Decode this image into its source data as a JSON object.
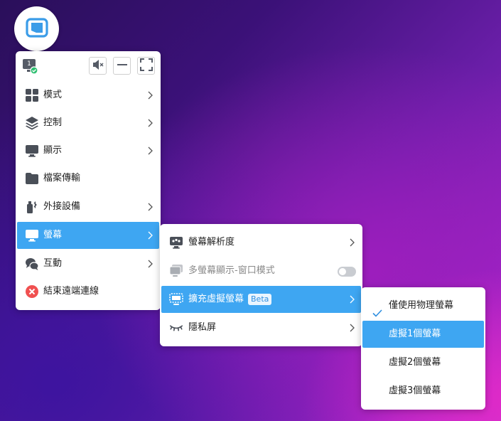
{
  "icons": {
    "app_logo": "app-logo-icon",
    "monitor_badge": "monitor-1-icon",
    "mute": "speaker-mute-icon",
    "minimize": "minimize-icon",
    "fullscreen": "fullscreen-icon"
  },
  "toolbar": {
    "monitor_number": "1"
  },
  "main_menu": {
    "items": [
      {
        "label": "模式",
        "icon": "grid-icon"
      },
      {
        "label": "控制",
        "icon": "layers-icon"
      },
      {
        "label": "顯示",
        "icon": "monitor-icon"
      },
      {
        "label": "檔案傳輸",
        "icon": "folder-icon"
      },
      {
        "label": "外接設備",
        "icon": "usb-icon"
      },
      {
        "label": "螢幕",
        "icon": "screen-icon"
      },
      {
        "label": "互動",
        "icon": "chat-icon"
      },
      {
        "label": "結束遠端連線",
        "icon": "close-circle-icon"
      }
    ]
  },
  "screen_submenu": {
    "items": [
      {
        "label": "螢幕解析度",
        "icon": "resolution-icon"
      },
      {
        "label": "多螢幕顯示-窗口模式",
        "icon": "multi-screen-icon",
        "toggle": false
      },
      {
        "label": "擴充虛擬螢幕",
        "icon": "virtual-screen-icon",
        "badge": "Beta"
      },
      {
        "label": "隱私屏",
        "icon": "eye-closed-icon"
      }
    ]
  },
  "virtual_submenu": {
    "items": [
      {
        "label": "僅使用物理螢幕",
        "checked": true
      },
      {
        "label": "虛擬1個螢幕"
      },
      {
        "label": "虛擬2個螢幕"
      },
      {
        "label": "虛擬3個螢幕"
      }
    ]
  },
  "colors": {
    "accent": "#3ea6f2",
    "close_red": "#f05050",
    "icon_gray": "#4a4f58"
  }
}
